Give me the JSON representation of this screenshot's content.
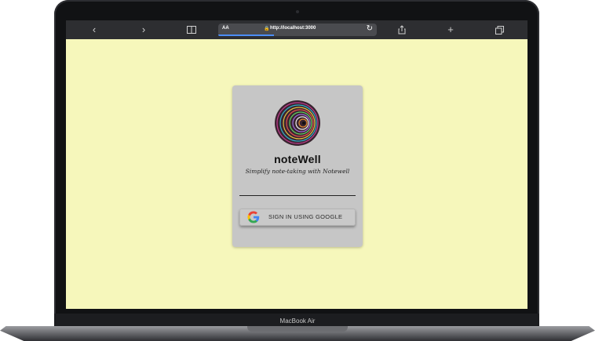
{
  "device": {
    "model_label": "MacBook Air"
  },
  "browser": {
    "back": "‹",
    "forward": "›",
    "reader_label": "AA",
    "url": "http://localhost:3000",
    "progress": 0.35,
    "add_tab": "+"
  },
  "login_card": {
    "brand_name": "noteWell",
    "tagline": "Simplify note-taking with Notewell",
    "google_button_label": "SIGN IN USING GOOGLE"
  },
  "colors": {
    "page_background": "#f6f7bb",
    "card_background": "#c6c6c6",
    "browser_toolbar": "#2d2e31"
  },
  "icons": [
    "back-icon",
    "forward-icon",
    "book-icon",
    "lock-icon",
    "reload-icon",
    "share-icon",
    "plus-icon",
    "tabs-icon",
    "google-icon",
    "logo-icon"
  ]
}
